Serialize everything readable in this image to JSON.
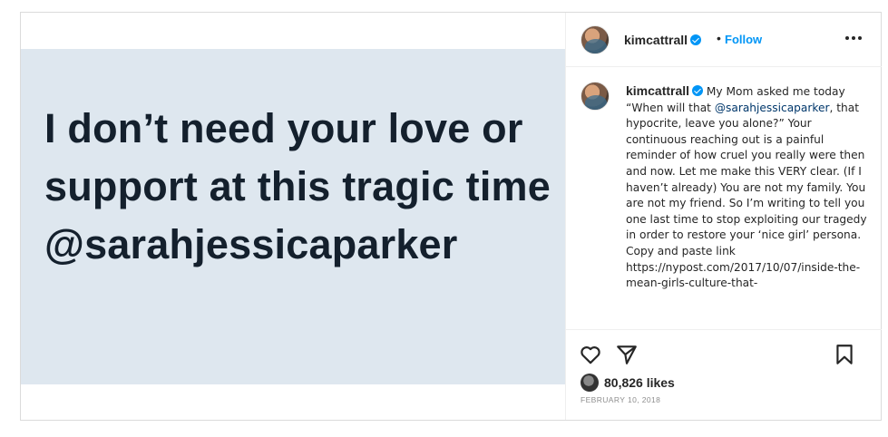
{
  "post": {
    "quote_text": "I don’t need your love or support at this tragic time @sarahjessicaparker"
  },
  "header": {
    "username": "kimcattrall",
    "separator": "•",
    "follow_label": "Follow"
  },
  "caption": {
    "username": "kimcattrall",
    "text_before_mention": "My Mom asked me today “When will that ",
    "mention": "@sarahjessicaparker",
    "text_after_mention": ", that hypocrite, leave you alone?” Your continuous reaching out is a painful reminder of how cruel you really were then and now. Let me make this VERY clear. (If I haven’t already) You are not my family. You are not my friend. So I’m writing to tell you one last time to stop exploiting our tragedy in order to restore your ‘nice girl’ persona. Copy and paste link https://nypost.com/2017/10/07/inside-the-mean-girls-culture-that-"
  },
  "stats": {
    "likes": "80,826 likes",
    "date": "FEBRUARY 10, 2018"
  },
  "icons": {
    "like": "heart-icon",
    "share": "paper-plane-icon",
    "save": "bookmark-icon",
    "more": "more-options-icon",
    "verified": "verified-badge-icon"
  },
  "colors": {
    "accent": "#0095f6",
    "mention": "#00376b",
    "image_background": "#dee7ef",
    "quote_text": "#14202d",
    "meta_text": "#8e8e8e"
  }
}
